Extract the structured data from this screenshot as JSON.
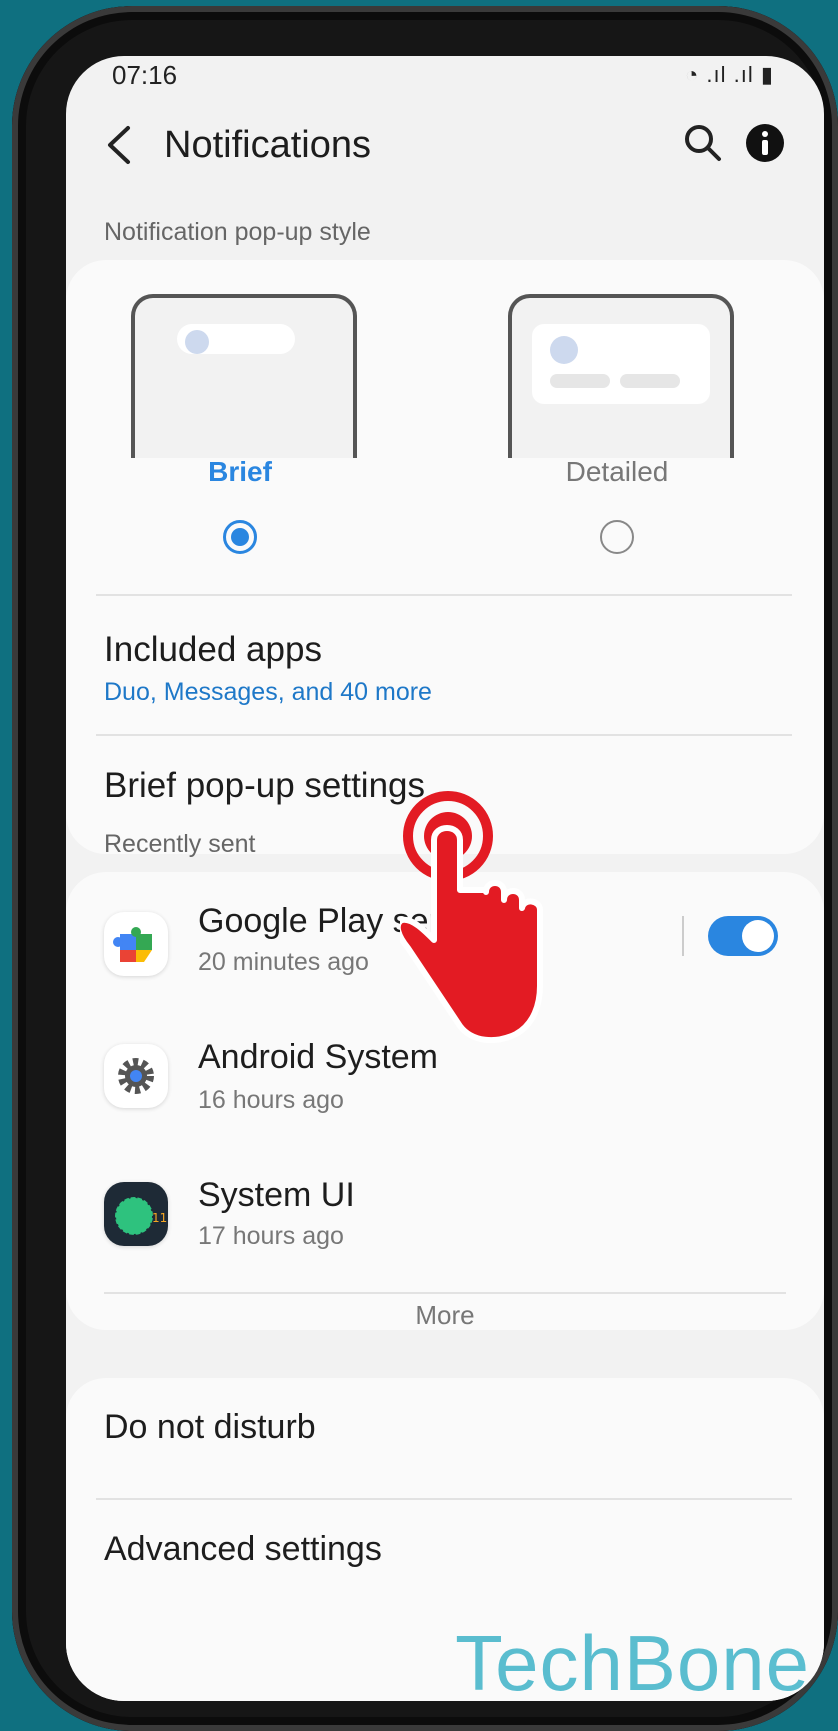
{
  "status_bar": {
    "time": "07:16",
    "icons": "◔ .ıl .ıl ▮"
  },
  "header": {
    "title": "Notifications"
  },
  "popup_style": {
    "section_label": "Notification pop-up style",
    "options": [
      {
        "label": "Brief",
        "selected": true
      },
      {
        "label": "Detailed",
        "selected": false
      }
    ]
  },
  "included_apps": {
    "title": "Included apps",
    "subtitle": "Duo, Messages, and 40 more"
  },
  "brief_settings": {
    "title": "Brief pop-up settings"
  },
  "recently_sent": {
    "section_label": "Recently sent",
    "apps": [
      {
        "name": "Google Play services",
        "time": "20 minutes ago",
        "icon": "google-play-services-icon",
        "toggle": true
      },
      {
        "name": "Android System",
        "time": "16 hours ago",
        "icon": "android-system-gear-icon"
      },
      {
        "name": "System UI",
        "time": "17 hours ago",
        "icon": "system-ui-icon"
      }
    ],
    "more_label": "More"
  },
  "do_not_disturb": {
    "title": "Do not disturb"
  },
  "advanced_settings": {
    "title": "Advanced settings"
  },
  "watermark": "TechBone",
  "colors": {
    "accent": "#2a86e0",
    "link": "#1e78c8",
    "background": "#f2f2f2",
    "card": "#fafafa",
    "outer": "#0f7080"
  }
}
